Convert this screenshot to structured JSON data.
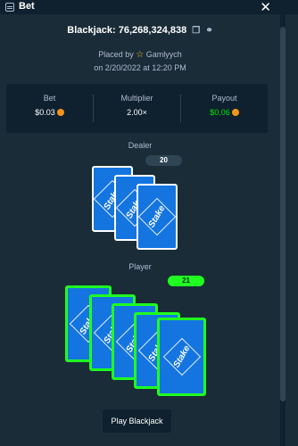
{
  "window": {
    "title": "Bet"
  },
  "bet": {
    "title": "Blackjack: 76,268,324,838",
    "placed_by_prefix": "Placed by",
    "user": "Gamlyych",
    "date": "on 2/20/2022 at 12:20 PM"
  },
  "stats": {
    "bet_label": "Bet",
    "bet_value": "$0.03",
    "multiplier_label": "Multiplier",
    "multiplier_value": "2.00×",
    "payout_label": "Payout",
    "payout_value": "$0.06"
  },
  "dealer": {
    "label": "Dealer",
    "score": "20",
    "card_count": 3
  },
  "player": {
    "label": "Player",
    "score": "21",
    "card_count": 5
  },
  "card_logo": "Stake",
  "actions": {
    "play_label": "Play Blackjack"
  },
  "colors": {
    "card_blue": "#1475e1",
    "win_green": "#1fff20",
    "background": "#1a2c38",
    "coin": "#f7931a"
  }
}
